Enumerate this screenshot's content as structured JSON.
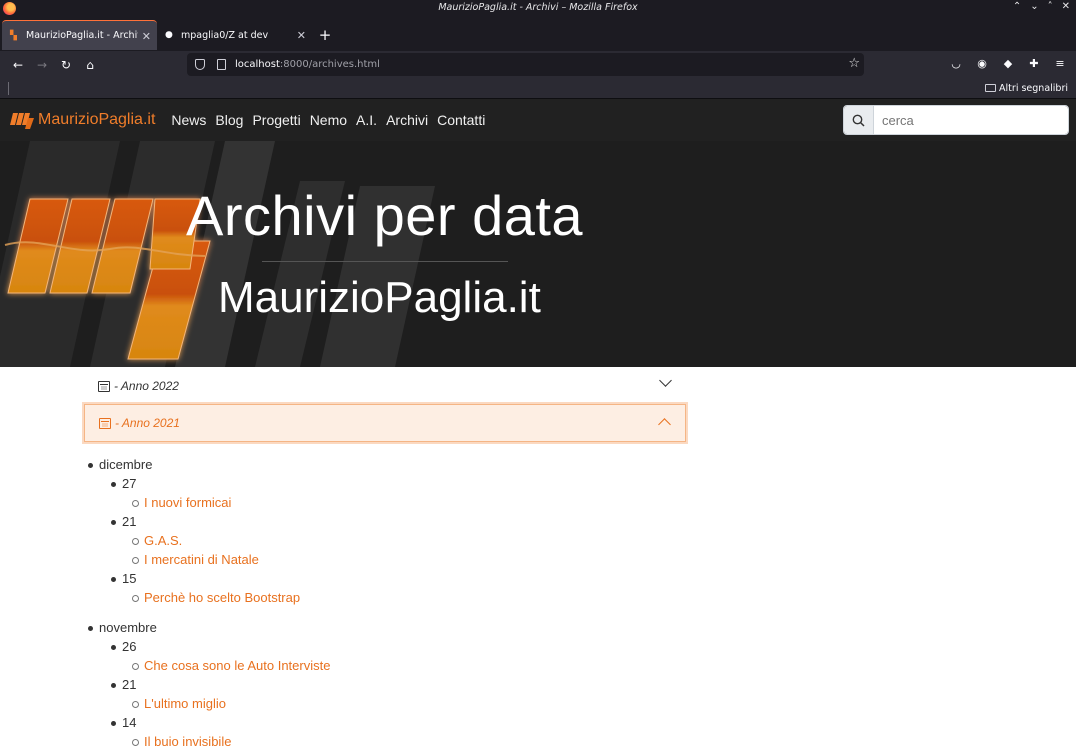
{
  "window": {
    "title": "MaurizioPaglia.it - Archivi – Mozilla Firefox"
  },
  "tabs": [
    {
      "label": "MaurizioPaglia.it - Archivi",
      "active": true
    },
    {
      "label": "mpaglia0/Z at dev",
      "active": false
    }
  ],
  "url": {
    "host": "localhost",
    "rest": ":8000/archives.html"
  },
  "bookmarks": {
    "other": "Altri segnalibri"
  },
  "site": {
    "brand": "MaurizioPaglia.it",
    "menu": [
      "News",
      "Blog",
      "Progetti",
      "Nemo",
      "A.I.",
      "Archivi",
      "Contatti"
    ],
    "search_placeholder": "cerca",
    "accent": "#e8711f"
  },
  "hero": {
    "title": "Archivi per data",
    "subtitle": "MaurizioPaglia.it"
  },
  "accordion": {
    "y2022": "- Anno 2022",
    "y2021": "- Anno 2021"
  },
  "archive": [
    {
      "month": "dicembre",
      "days": [
        {
          "day": "27",
          "posts": [
            "I nuovi formicai"
          ]
        },
        {
          "day": "21",
          "posts": [
            "G.A.S.",
            "I mercatini di Natale"
          ]
        },
        {
          "day": "15",
          "posts": [
            "Perchè ho scelto Bootstrap"
          ]
        }
      ]
    },
    {
      "month": "novembre",
      "days": [
        {
          "day": "26",
          "posts": [
            "Che cosa sono le Auto Interviste"
          ]
        },
        {
          "day": "21",
          "posts": [
            "L'ultimo miglio"
          ]
        },
        {
          "day": "14",
          "posts": [
            "Il buio invisibile"
          ]
        }
      ]
    }
  ]
}
